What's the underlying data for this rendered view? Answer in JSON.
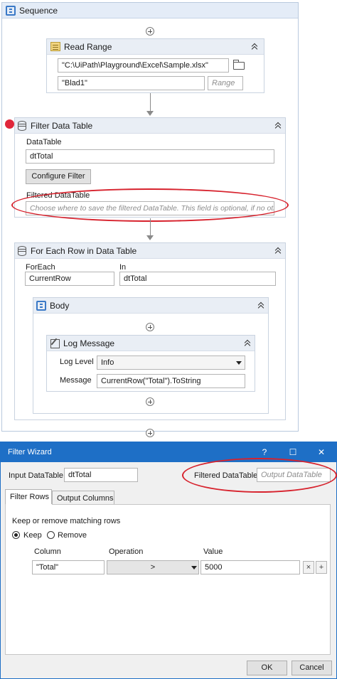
{
  "designer": {
    "sequence_title": "Sequence",
    "read_range": {
      "title": "Read Range",
      "path_value": "\"C:\\UiPath\\Playground\\Excel\\Sample.xlsx\"",
      "sheet_value": "\"Blad1\"",
      "range_placeholder": "Range"
    },
    "filter_data_table": {
      "title": "Filter Data Table",
      "datatable_label": "DataTable",
      "datatable_value": "dtTotal",
      "configure_button": "Configure Filter",
      "filtered_label": "Filtered DataTable",
      "filtered_placeholder": "Choose where to save the filtered DataTable. This field is optional, if no oth"
    },
    "for_each_row": {
      "title": "For Each Row in Data Table",
      "foreach_label": "ForEach",
      "foreach_value": "CurrentRow",
      "in_label": "In",
      "in_value": "dtTotal",
      "body_title": "Body",
      "log_message": {
        "title": "Log Message",
        "level_label": "Log Level",
        "level_value": "Info",
        "message_label": "Message",
        "message_value": "CurrentRow(\"Total\").ToString"
      }
    }
  },
  "wizard": {
    "title": "Filter Wizard",
    "help_symbol": "?",
    "maximize_symbol": "☐",
    "close_symbol": "✕",
    "input_label": "Input DataTable",
    "input_value": "dtTotal",
    "output_label": "Filtered DataTable",
    "output_placeholder": "Output DataTable",
    "tabs": [
      "Filter Rows",
      "Output Columns"
    ],
    "section_label": "Keep or remove matching rows",
    "keep_label": "Keep",
    "remove_label": "Remove",
    "columns": {
      "column": "Column",
      "operation": "Operation",
      "value": "Value"
    },
    "row": {
      "column": "\"Total\"",
      "operation": ">",
      "value": "5000"
    },
    "remove_row_symbol": "×",
    "add_row_symbol": "+",
    "ok_label": "OK",
    "cancel_label": "Cancel"
  },
  "colors": {
    "accent_blue": "#1e6fc6",
    "annotation_red": "#d7222d",
    "breakpoint_red": "#e0263a"
  }
}
